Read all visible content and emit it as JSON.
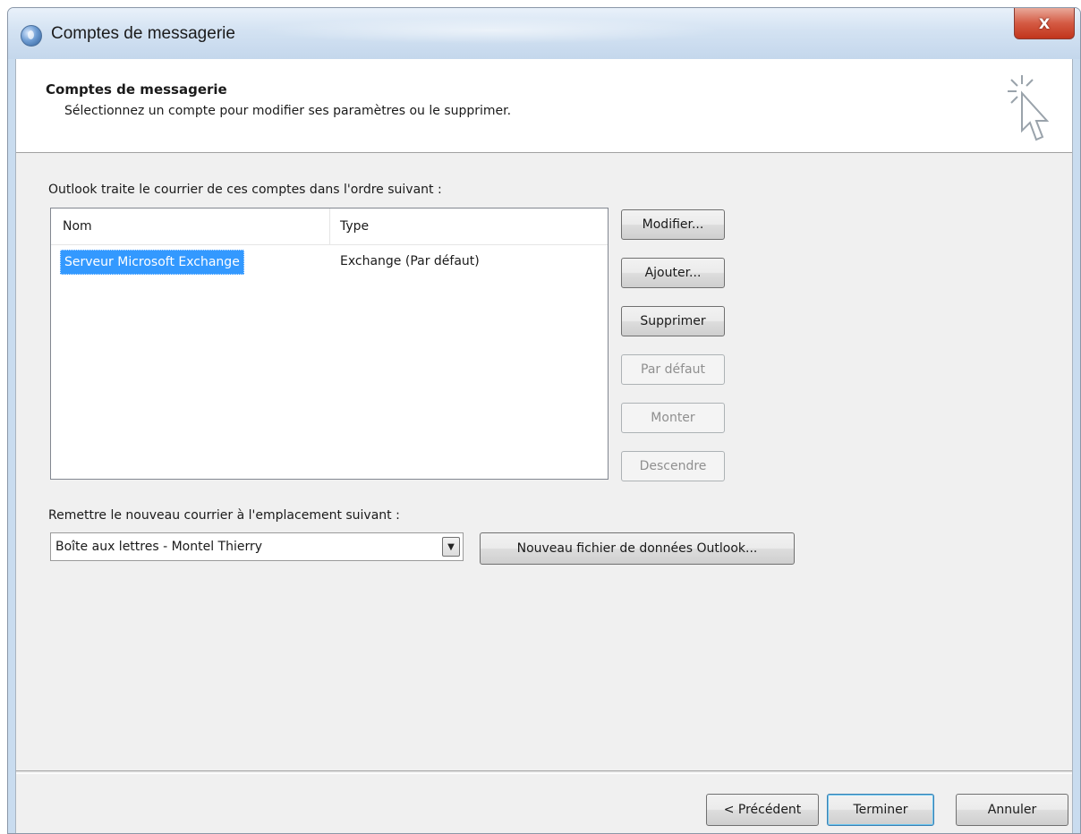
{
  "window": {
    "title": "Comptes de messagerie",
    "close_label": "X"
  },
  "header": {
    "title": "Comptes de messagerie",
    "subtitle": "Sélectionnez un compte pour modifier ses paramètres ou le supprimer."
  },
  "accounts": {
    "label": "Outlook traite le courrier de ces comptes dans l'ordre suivant :",
    "columns": [
      "Nom",
      "Type"
    ],
    "rows": [
      {
        "name": "Serveur Microsoft Exchange",
        "type": "Exchange (Par défaut)",
        "selected": true
      }
    ]
  },
  "side_buttons": {
    "modify": "Modifier...",
    "add": "Ajouter...",
    "remove": "Supprimer",
    "set_default": "Par défaut",
    "move_up": "Monter",
    "move_down": "Descendre"
  },
  "delivery": {
    "label": "Remettre le nouveau courrier à l'emplacement suivant :",
    "selected": "Boîte aux lettres - Montel Thierry",
    "new_data_file": "Nouveau fichier de données Outlook..."
  },
  "footer": {
    "back": "< Précédent",
    "finish": "Terminer",
    "cancel": "Annuler"
  },
  "colors": {
    "selection": "#3399ff",
    "titlebar": "#d3e2f2",
    "close": "#c1351c",
    "dialog_bg": "#f0f0f0"
  }
}
